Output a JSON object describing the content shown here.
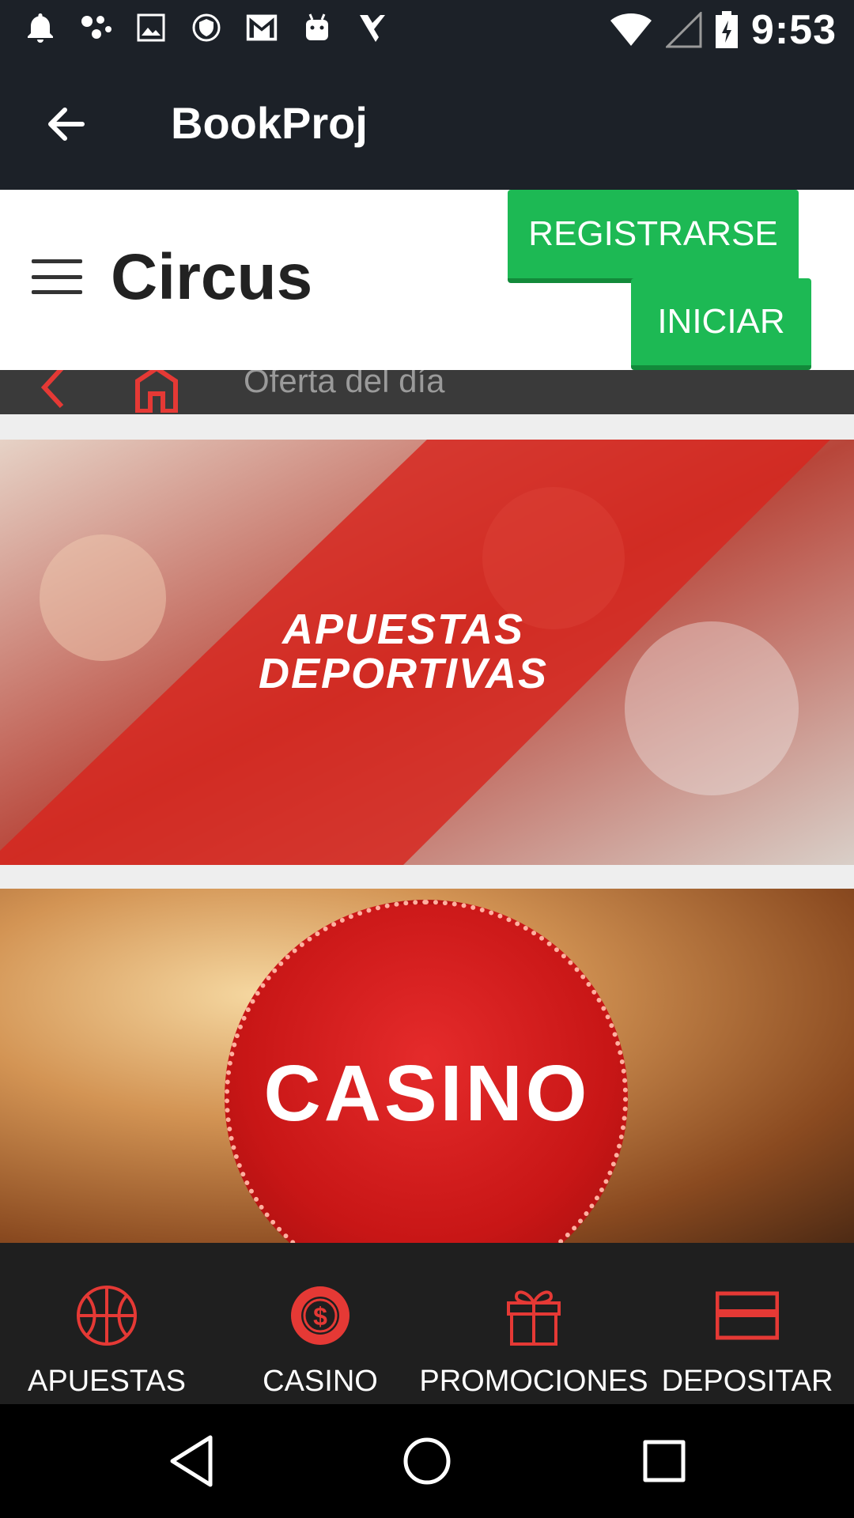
{
  "status_bar": {
    "time": "9:53",
    "icons": [
      "notification-bell-icon",
      "app-icon",
      "image-icon",
      "shield-icon",
      "gmail-icon",
      "android-icon",
      "check-icon"
    ],
    "right_icons": [
      "wifi-icon",
      "signal-icon",
      "battery-charging-icon"
    ]
  },
  "app_bar": {
    "title": "BookProj",
    "back_icon": "arrow-left-icon"
  },
  "site_header": {
    "logo_text": "Circus",
    "register_label": "REGISTRARSE",
    "login_label": "INICIAR",
    "accent_color": "#1db954"
  },
  "subnav": {
    "text": "Oferta del día"
  },
  "banners": {
    "sports_title_line1": "APUESTAS",
    "sports_title_line2": "DEPORTIVAS",
    "casino_title": "CASINO"
  },
  "bottom_nav": {
    "items": [
      {
        "label": "APUESTAS",
        "icon": "basketball-icon"
      },
      {
        "label": "CASINO",
        "icon": "casino-chip-icon"
      },
      {
        "label": "PROMOCIONES",
        "icon": "gift-icon"
      },
      {
        "label": "DEPOSITAR",
        "icon": "card-icon"
      }
    ],
    "icon_color": "#e53935"
  },
  "system_bar": {
    "buttons": [
      "back-triangle-icon",
      "home-circle-icon",
      "recents-square-icon"
    ]
  }
}
